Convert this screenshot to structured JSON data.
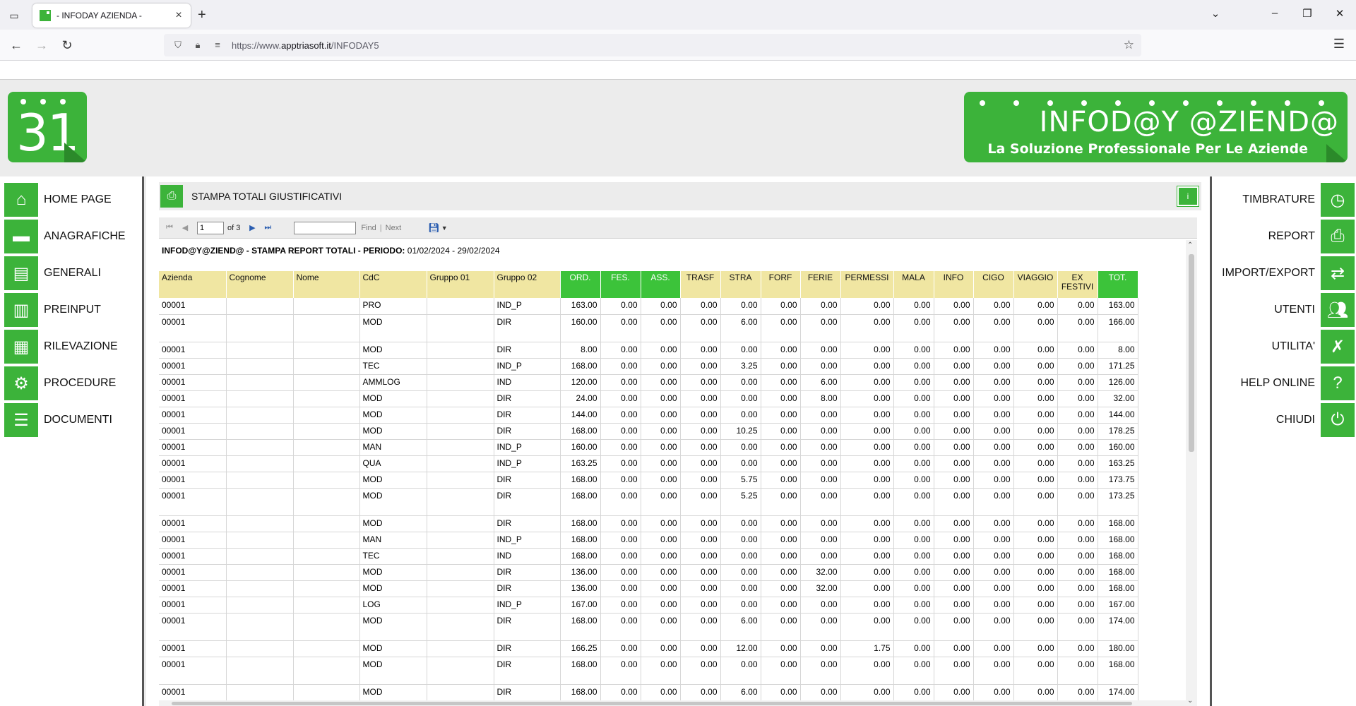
{
  "browser": {
    "tab_title": "- INFODAY AZIENDA -",
    "url_prefix": "https://www.",
    "url_host": "apptriasoft.it",
    "url_path": "/INFODAY5"
  },
  "header": {
    "logo_number": "31",
    "banner_title": "INFOD@Y @ZIEND@",
    "banner_subtitle": "La Soluzione Professionale Per Le Aziende"
  },
  "left_menu": [
    {
      "label": "HOME PAGE",
      "icon": "home-icon"
    },
    {
      "label": "ANAGRAFICHE",
      "icon": "folder-icon"
    },
    {
      "label": "GENERALI",
      "icon": "list-icon"
    },
    {
      "label": "PREINPUT",
      "icon": "columns-icon"
    },
    {
      "label": "RILEVAZIONE",
      "icon": "grid-icon"
    },
    {
      "label": "PROCEDURE",
      "icon": "gear-icon"
    },
    {
      "label": "DOCUMENTI",
      "icon": "document-icon"
    }
  ],
  "right_menu": [
    {
      "label": "TIMBRATURE",
      "icon": "clock-icon"
    },
    {
      "label": "REPORT",
      "icon": "printer-icon"
    },
    {
      "label": "IMPORT/EXPORT",
      "icon": "swap-arrows-icon"
    },
    {
      "label": "UTENTI",
      "icon": "users-icon"
    },
    {
      "label": "UTILITA'",
      "icon": "tools-icon"
    },
    {
      "label": "HELP ONLINE",
      "icon": "help-icon"
    },
    {
      "label": "CHIUDI",
      "icon": "power-icon"
    }
  ],
  "page": {
    "title": "STAMPA TOTALI GIUSTIFICATIVI",
    "info_button": "i"
  },
  "toolbar": {
    "current_page": "1",
    "of_pages": "of 3",
    "find_value": "",
    "find_label": "Find",
    "separator": "|",
    "next_label": "Next"
  },
  "report": {
    "heading_bold": "INFOD@Y@ZIEND@ - STAMPA REPORT TOTALI - PERIODO:",
    "heading_period": "01/02/2024 - 29/02/2024",
    "columns": [
      "Azienda",
      "Cognome",
      "Nome",
      "CdC",
      "Gruppo 01",
      "Gruppo 02",
      "ORD.",
      "FES.",
      "ASS.",
      "TRASF",
      "STRA",
      "FORF",
      "FERIE",
      "PERMESSI",
      "MALA",
      "INFO",
      "CIGO",
      "VIAGGIO",
      "EX FESTIVI",
      "TOT."
    ],
    "rows": [
      [
        "00001",
        "",
        "",
        "PRO",
        "",
        "IND_P",
        "163.00",
        "0.00",
        "0.00",
        "0.00",
        "0.00",
        "0.00",
        "0.00",
        "0.00",
        "0.00",
        "0.00",
        "0.00",
        "0.00",
        "0.00",
        "163.00"
      ],
      [
        "00001",
        "",
        "",
        "MOD",
        "",
        "DIR",
        "160.00",
        "0.00",
        "0.00",
        "0.00",
        "6.00",
        "0.00",
        "0.00",
        "0.00",
        "0.00",
        "0.00",
        "0.00",
        "0.00",
        "0.00",
        "166.00"
      ],
      [
        "00001",
        "",
        "",
        "MOD",
        "",
        "DIR",
        "8.00",
        "0.00",
        "0.00",
        "0.00",
        "0.00",
        "0.00",
        "0.00",
        "0.00",
        "0.00",
        "0.00",
        "0.00",
        "0.00",
        "0.00",
        "8.00"
      ],
      [
        "00001",
        "",
        "",
        "TEC",
        "",
        "IND_P",
        "168.00",
        "0.00",
        "0.00",
        "0.00",
        "3.25",
        "0.00",
        "0.00",
        "0.00",
        "0.00",
        "0.00",
        "0.00",
        "0.00",
        "0.00",
        "171.25"
      ],
      [
        "00001",
        "",
        "",
        "AMMLOG",
        "",
        "IND",
        "120.00",
        "0.00",
        "0.00",
        "0.00",
        "0.00",
        "0.00",
        "6.00",
        "0.00",
        "0.00",
        "0.00",
        "0.00",
        "0.00",
        "0.00",
        "126.00"
      ],
      [
        "00001",
        "",
        "",
        "MOD",
        "",
        "DIR",
        "24.00",
        "0.00",
        "0.00",
        "0.00",
        "0.00",
        "0.00",
        "8.00",
        "0.00",
        "0.00",
        "0.00",
        "0.00",
        "0.00",
        "0.00",
        "32.00"
      ],
      [
        "00001",
        "",
        "",
        "MOD",
        "",
        "DIR",
        "144.00",
        "0.00",
        "0.00",
        "0.00",
        "0.00",
        "0.00",
        "0.00",
        "0.00",
        "0.00",
        "0.00",
        "0.00",
        "0.00",
        "0.00",
        "144.00"
      ],
      [
        "00001",
        "",
        "",
        "MOD",
        "",
        "DIR",
        "168.00",
        "0.00",
        "0.00",
        "0.00",
        "10.25",
        "0.00",
        "0.00",
        "0.00",
        "0.00",
        "0.00",
        "0.00",
        "0.00",
        "0.00",
        "178.25"
      ],
      [
        "00001",
        "",
        "",
        "MAN",
        "",
        "IND_P",
        "160.00",
        "0.00",
        "0.00",
        "0.00",
        "0.00",
        "0.00",
        "0.00",
        "0.00",
        "0.00",
        "0.00",
        "0.00",
        "0.00",
        "0.00",
        "160.00"
      ],
      [
        "00001",
        "",
        "",
        "QUA",
        "",
        "IND_P",
        "163.25",
        "0.00",
        "0.00",
        "0.00",
        "0.00",
        "0.00",
        "0.00",
        "0.00",
        "0.00",
        "0.00",
        "0.00",
        "0.00",
        "0.00",
        "163.25"
      ],
      [
        "00001",
        "",
        "",
        "MOD",
        "",
        "DIR",
        "168.00",
        "0.00",
        "0.00",
        "0.00",
        "5.75",
        "0.00",
        "0.00",
        "0.00",
        "0.00",
        "0.00",
        "0.00",
        "0.00",
        "0.00",
        "173.75"
      ],
      [
        "00001",
        "",
        "",
        "MOD",
        "",
        "DIR",
        "168.00",
        "0.00",
        "0.00",
        "0.00",
        "5.25",
        "0.00",
        "0.00",
        "0.00",
        "0.00",
        "0.00",
        "0.00",
        "0.00",
        "0.00",
        "173.25"
      ],
      [
        "00001",
        "",
        "",
        "MOD",
        "",
        "DIR",
        "168.00",
        "0.00",
        "0.00",
        "0.00",
        "0.00",
        "0.00",
        "0.00",
        "0.00",
        "0.00",
        "0.00",
        "0.00",
        "0.00",
        "0.00",
        "168.00"
      ],
      [
        "00001",
        "",
        "",
        "MAN",
        "",
        "IND_P",
        "168.00",
        "0.00",
        "0.00",
        "0.00",
        "0.00",
        "0.00",
        "0.00",
        "0.00",
        "0.00",
        "0.00",
        "0.00",
        "0.00",
        "0.00",
        "168.00"
      ],
      [
        "00001",
        "",
        "",
        "TEC",
        "",
        "IND",
        "168.00",
        "0.00",
        "0.00",
        "0.00",
        "0.00",
        "0.00",
        "0.00",
        "0.00",
        "0.00",
        "0.00",
        "0.00",
        "0.00",
        "0.00",
        "168.00"
      ],
      [
        "00001",
        "",
        "",
        "MOD",
        "",
        "DIR",
        "136.00",
        "0.00",
        "0.00",
        "0.00",
        "0.00",
        "0.00",
        "32.00",
        "0.00",
        "0.00",
        "0.00",
        "0.00",
        "0.00",
        "0.00",
        "168.00"
      ],
      [
        "00001",
        "",
        "",
        "MOD",
        "",
        "DIR",
        "136.00",
        "0.00",
        "0.00",
        "0.00",
        "0.00",
        "0.00",
        "32.00",
        "0.00",
        "0.00",
        "0.00",
        "0.00",
        "0.00",
        "0.00",
        "168.00"
      ],
      [
        "00001",
        "",
        "",
        "LOG",
        "",
        "IND_P",
        "167.00",
        "0.00",
        "0.00",
        "0.00",
        "0.00",
        "0.00",
        "0.00",
        "0.00",
        "0.00",
        "0.00",
        "0.00",
        "0.00",
        "0.00",
        "167.00"
      ],
      [
        "00001",
        "",
        "",
        "MOD",
        "",
        "DIR",
        "168.00",
        "0.00",
        "0.00",
        "0.00",
        "6.00",
        "0.00",
        "0.00",
        "0.00",
        "0.00",
        "0.00",
        "0.00",
        "0.00",
        "0.00",
        "174.00"
      ],
      [
        "00001",
        "",
        "",
        "MOD",
        "",
        "DIR",
        "166.25",
        "0.00",
        "0.00",
        "0.00",
        "12.00",
        "0.00",
        "0.00",
        "1.75",
        "0.00",
        "0.00",
        "0.00",
        "0.00",
        "0.00",
        "180.00"
      ],
      [
        "00001",
        "",
        "",
        "MOD",
        "",
        "DIR",
        "168.00",
        "0.00",
        "0.00",
        "0.00",
        "0.00",
        "0.00",
        "0.00",
        "0.00",
        "0.00",
        "0.00",
        "0.00",
        "0.00",
        "0.00",
        "168.00"
      ],
      [
        "00001",
        "",
        "",
        "MOD",
        "",
        "DIR",
        "168.00",
        "0.00",
        "0.00",
        "0.00",
        "6.00",
        "0.00",
        "0.00",
        "0.00",
        "0.00",
        "0.00",
        "0.00",
        "0.00",
        "0.00",
        "174.00"
      ]
    ]
  },
  "colors": {
    "brand_green": "#3cb33a",
    "header_yellow": "#f0e6a2",
    "header_green": "#3cc33a"
  }
}
